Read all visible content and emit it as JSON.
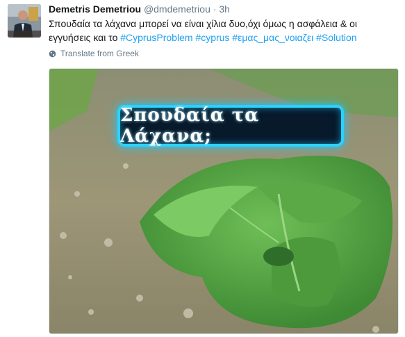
{
  "tweet": {
    "author_name": "Demetris Demetriou",
    "author_handle": "@dmdemetriou",
    "separator": "·",
    "timestamp": "3h",
    "text_plain": "Σπουδαία τα λάχανα μπορεί να είναι χίλια δυο,όχι όμως η ασφάλεια & οι εγγυήσεις και το",
    "hashtags": [
      "#CyprusProblem",
      "#cyprus",
      "#εμας_μας_νοιαζει",
      "#Solution"
    ],
    "translate_label": "Translate from Greek",
    "media": {
      "caption": "Σπουδαία τα Λάχανα;"
    }
  },
  "icons": {
    "avatar": "avatar-photo",
    "translate": "globe-icon"
  },
  "colors": {
    "hashtag": "#1da1f2",
    "secondary_text": "#657786",
    "caption_border": "#2ad2ff"
  }
}
